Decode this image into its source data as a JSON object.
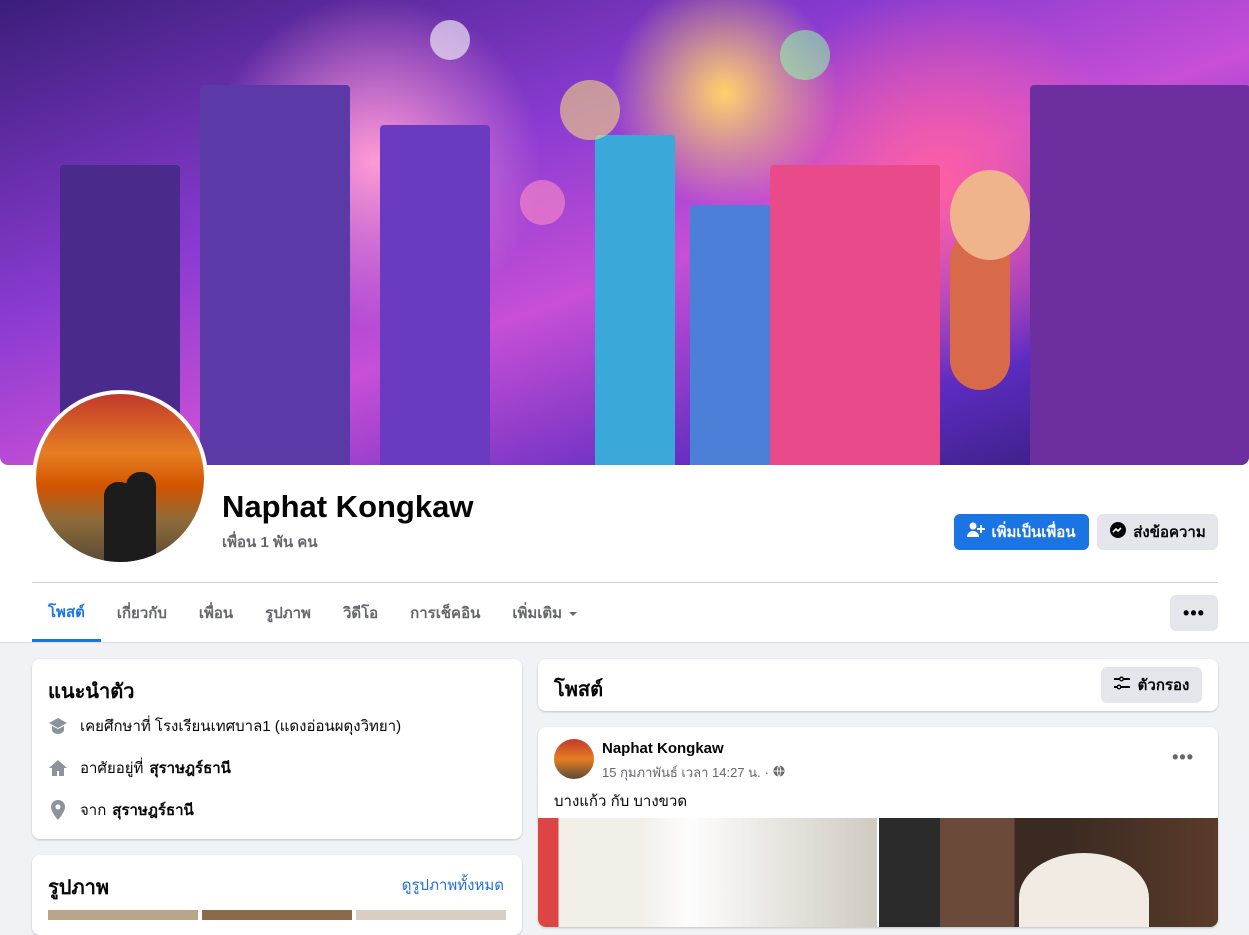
{
  "profile": {
    "name": "Naphat Kongkaw",
    "friends": "เพื่อน 1 พัน คน",
    "add_friend_label": "เพิ่มเป็นเพื่อน",
    "message_label": "ส่งข้อความ"
  },
  "tabs": [
    {
      "label": "โพสต์",
      "active": true
    },
    {
      "label": "เกี่ยวกับ"
    },
    {
      "label": "เพื่อน"
    },
    {
      "label": "รูปภาพ"
    },
    {
      "label": "วิดีโอ"
    },
    {
      "label": "การเช็คอิน"
    },
    {
      "label": "เพิ่มเติม"
    }
  ],
  "more_menu": "•••",
  "intro": {
    "title": "แนะนำตัว",
    "education": "เคยศึกษาที่ โรงเรียนเทศบาล1 (แดงอ่อนผดุงวิทยา)",
    "lives_prefix": "อาศัยอยู่ที่",
    "lives_place": "สุราษฎร์ธานี",
    "from_prefix": "จาก",
    "from_place": "สุราษฎร์ธานี"
  },
  "photos": {
    "title": "รูปภาพ",
    "see_all": "ดูรูปภาพทั้งหมด"
  },
  "posts": {
    "title": "โพสต์",
    "filter_label": "ตัวกรอง"
  },
  "post": {
    "author": "Naphat Kongkaw",
    "time": "15 กุมภาพันธ์ เวลา 14:27 น.",
    "separator": "·",
    "text": "บางแก้ว กับ บางขวด",
    "menu": "•••"
  },
  "colors": {
    "primary": "#1b74e4",
    "secondary_bg": "#e4e6eb",
    "page_bg": "#f0f2f5",
    "muted_text": "#65676b"
  }
}
